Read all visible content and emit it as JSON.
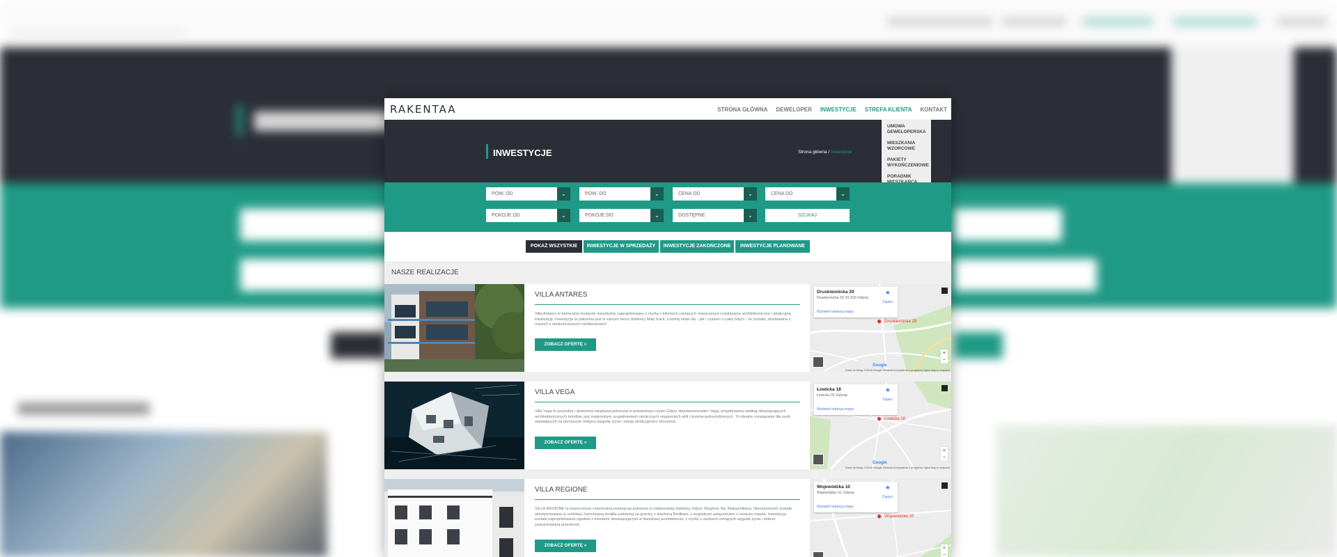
{
  "header": {
    "logo": "RAKENTAA",
    "nav": [
      "STRONA GŁÓWNA",
      "DEWELOPER",
      "INWESTYCJE",
      "STREFA KLIENTA",
      "KONTAKT"
    ],
    "dropdown": [
      "UMOWA DEWELOPERSKA",
      "MIESZKANIA WZORCOWE",
      "PAKIETY WYKOŃCZENIOWE",
      "PORADNIK MIESZKAŃCA"
    ]
  },
  "hero": {
    "title": "INWESTYCJE",
    "breadcrumb_home": "Strona główna",
    "breadcrumb_sep": "/",
    "breadcrumb_current": "Inwestycje"
  },
  "filters": {
    "pow_od": "POW. OD",
    "pow_do": "POW. DO",
    "cena_od": "CENA OD",
    "cena_do": "CENA DO",
    "pokoje_od": "POKOJE OD",
    "pokoje_do": "POKOJE DO",
    "dostepne": "DOSTĘPNE",
    "search": "SZUKAJ"
  },
  "tabs": [
    "POKAŻ WSZYSTKIE",
    "INWESTYCJE W SPRZEDAŻY",
    "INWESTYCJE ZAKOŃCZONE",
    "INWESTYCJE PLANOWANE"
  ],
  "section_title": "NASZE REALIZACJE",
  "projects": [
    {
      "title": "VILLA ANTARES",
      "description": "Villa Antares to kameralny budynek mieszkalny zaprojektowany z myślą o klientach ceniących nowoczesne rozwiązania architektoniczne i atrakcyjną lokalizację. Inwestycja ta położona jest w samym sercu dzielnicy Mały Kack, o której mówi się - jak i czasem o całej Gdyni - że została „zbudowana z marzeń o nieskończonych możliwościach\".",
      "button": "ZOBACZ OFERTĘ",
      "map_title": "Druskiennicka 29",
      "map_address": "Druskiennicka 29, 81-533 Gdynia",
      "map_link": "Wyświetl większą mapę",
      "map_save": "Zapisz",
      "pin_label": "Druskiennicka 29",
      "map_attr": "Dane do Mapy ©2018 Google   Warunki korzystania z programu   Zgłoś błąd w mapach"
    },
    {
      "title": "VILLA VEGA",
      "description": "Villa Vega to przytulna i dyskretna inicjatywa położona w południowej części Gdyni. Apartamentowiec Vega, projektowany według obowiązujących architektonicznych trendów, jest znakomitym uzupełnieniem okolicznych eleganckich willi i domów jednorodzinnych. To idealne rozwiązanie dla osób stawiających na pierwszym miejscu wygodę życia i ostoję atrakcyjności otoczenia.",
      "button": "ZOBACZ OFERTĘ",
      "map_title": "Łowicka 18",
      "map_address": "Łowicka 18, Gdynia",
      "map_link": "Wyświetl większą mapę",
      "map_save": "Zapisz",
      "pin_label": "Łowicka 18",
      "map_attr": "Dane do Mapy ©2018 Google   Warunki korzystania z programu   Zgłoś błąd w mapach"
    },
    {
      "title": "VILLA REGIONE",
      "description": "VILLA REGIONE to nowoczesna i kameralna inwestycja położona w nadmorskiej dzielnicy Gdyni: Wzgórze Św. Maksymiliana. Nieruchomość została skomponowana w urokliwą i harmonijną działkę położoną na granicy z dzielnicą Redłowo, z wygodnym połączeniem z centrum miasta. Inwestycja została zaprojektowana zgodnie z trendami obowiązującymi w światowej architekturze, z myślą o osobach ceniących wygodę życia i dobrze zaaranżowaną przestrzeń.",
      "button": "ZOBACZ OFERTĘ",
      "map_title": "Wojewódzka 10",
      "map_address": "Wojewódzka 10, Gdynia",
      "map_link": "Wyświetl większą mapę",
      "map_save": "Zapisz",
      "pin_label": "Wojewódzka 10",
      "map_attr": ""
    }
  ],
  "colors": {
    "accent": "#1f9a86",
    "dark": "#2b2e36"
  }
}
